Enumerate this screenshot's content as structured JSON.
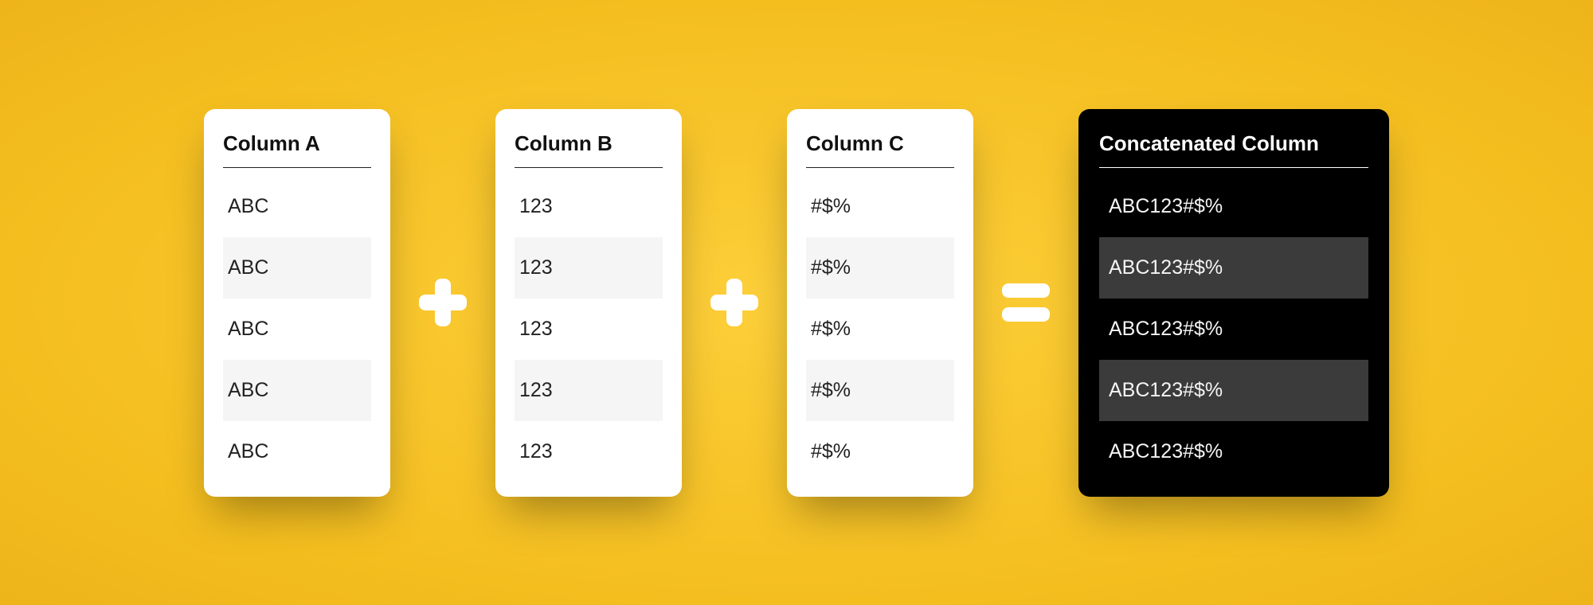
{
  "operators": {
    "plus": "+",
    "equals": "="
  },
  "columns": [
    {
      "header": "Column A",
      "rows": [
        "ABC",
        "ABC",
        "ABC",
        "ABC",
        "ABC"
      ]
    },
    {
      "header": "Column B",
      "rows": [
        "123",
        "123",
        "123",
        "123",
        "123"
      ]
    },
    {
      "header": "Column C",
      "rows": [
        "#$%",
        "#$%",
        "#$%",
        "#$%",
        "#$%"
      ]
    }
  ],
  "result": {
    "header": "Concatenated Column",
    "rows": [
      "ABC123#$%",
      "ABC123#$%",
      "ABC123#$%",
      "ABC123#$%",
      "ABC123#$%"
    ]
  }
}
